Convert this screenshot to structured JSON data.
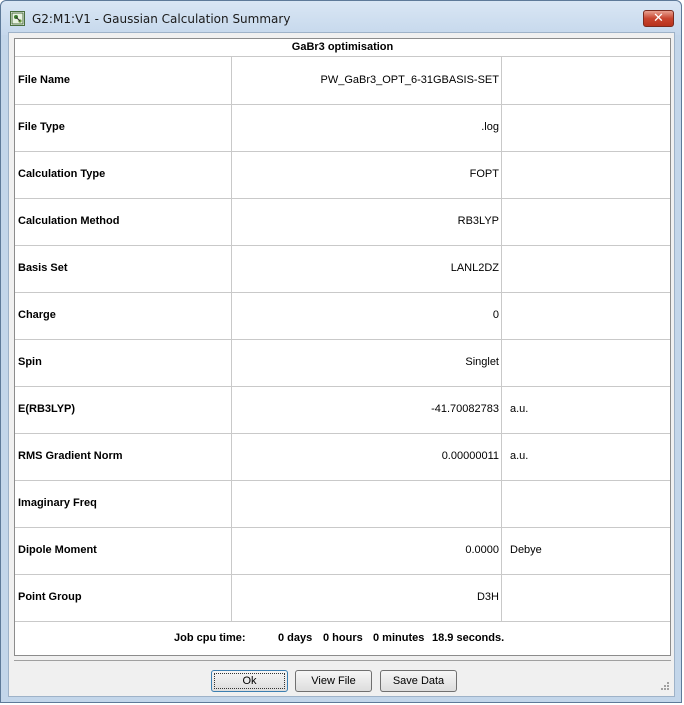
{
  "window": {
    "title": "G2:M1:V1 - Gaussian Calculation Summary",
    "close_label": "✕"
  },
  "table": {
    "header": "GaBr3 optimisation",
    "rows": [
      {
        "label": "File Name",
        "value": "PW_GaBr3_OPT_6-31GBASIS-SET",
        "unit": ""
      },
      {
        "label": "File Type",
        "value": ".log",
        "unit": ""
      },
      {
        "label": "Calculation Type",
        "value": "FOPT",
        "unit": ""
      },
      {
        "label": "Calculation Method",
        "value": "RB3LYP",
        "unit": ""
      },
      {
        "label": "Basis Set",
        "value": "LANL2DZ",
        "unit": ""
      },
      {
        "label": "Charge",
        "value": "0",
        "unit": ""
      },
      {
        "label": "Spin",
        "value": "Singlet",
        "unit": ""
      },
      {
        "label": "E(RB3LYP)",
        "value": "-41.70082783",
        "unit": "a.u."
      },
      {
        "label": "RMS Gradient Norm",
        "value": "0.00000011",
        "unit": "a.u."
      },
      {
        "label": "Imaginary Freq",
        "value": "",
        "unit": ""
      },
      {
        "label": "Dipole Moment",
        "value": "0.0000",
        "unit": "Debye"
      },
      {
        "label": "Point Group",
        "value": "D3H",
        "unit": ""
      }
    ],
    "footer": {
      "label": "Job cpu time:",
      "days": "0 days",
      "hours": "0 hours",
      "minutes": "0 minutes",
      "seconds": "18.9 seconds."
    }
  },
  "buttons": {
    "ok": "Ok",
    "view_file": "View File",
    "save_data": "Save Data"
  },
  "colors": {
    "window_frame": "#c3d6ea",
    "close_button": "#c8452f"
  }
}
